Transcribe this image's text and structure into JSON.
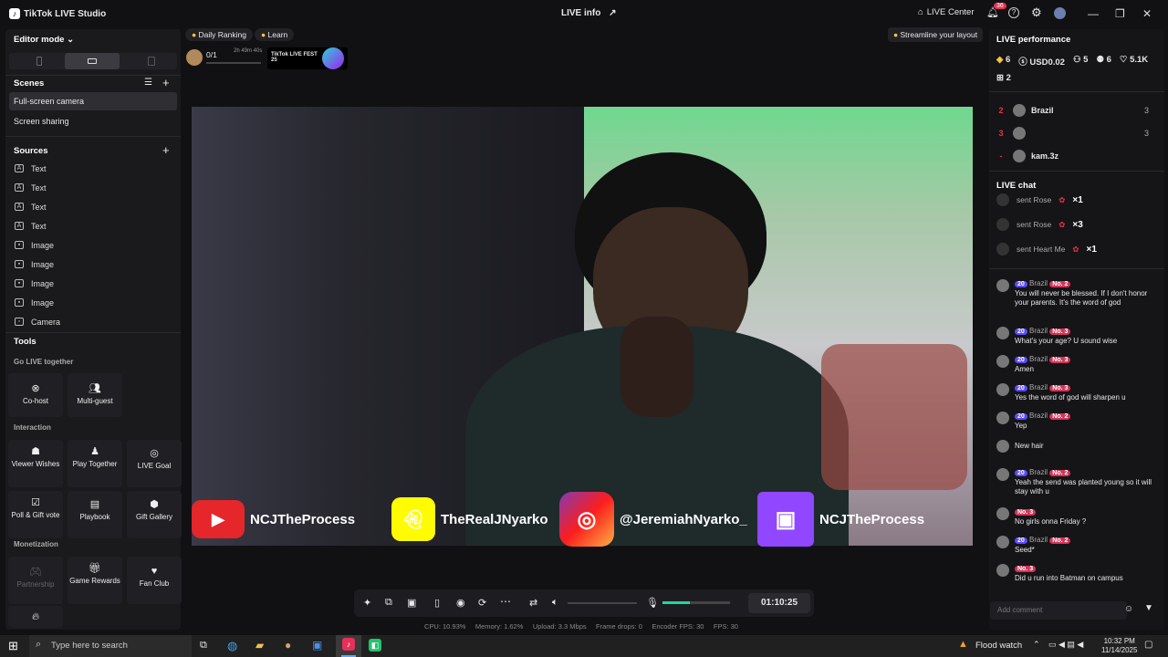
{
  "titlebar": {
    "app_title": "TikTok LIVE Studio",
    "center_title": "LIVE info",
    "live_center": "LIVE Center",
    "notif_count": "36"
  },
  "left": {
    "editor_mode": "Editor mode",
    "scenes_title": "Scenes",
    "scenes": [
      "Full-screen camera",
      "Screen sharing"
    ],
    "sources_title": "Sources",
    "sources": [
      {
        "label": "Text",
        "icon": "text-icon"
      },
      {
        "label": "Text",
        "icon": "text-icon"
      },
      {
        "label": "Text",
        "icon": "text-icon"
      },
      {
        "label": "Text",
        "icon": "text-icon"
      },
      {
        "label": "Image",
        "icon": "image-icon"
      },
      {
        "label": "Image",
        "icon": "image-icon"
      },
      {
        "label": "Image",
        "icon": "image-icon"
      },
      {
        "label": "Image",
        "icon": "image-icon"
      },
      {
        "label": "Camera",
        "icon": "camera-icon"
      }
    ],
    "tools_title": "Tools",
    "go_live_together": "Go LIVE together",
    "cohost": "Co-host",
    "multiguest": "Multi-guest",
    "interaction": "Interaction",
    "viewer_wishes": "Viewer Wishes",
    "play_together": "Play Together",
    "live_goal": "LIVE Goal",
    "poll_gift": "Poll & Gift vote",
    "playbook": "Playbook",
    "gift_gallery": "Gift Gallery",
    "monetization": "Monetization",
    "partnership": "Partnership",
    "game_rewards": "Game Rewards",
    "fan_club": "Fan Club"
  },
  "top": {
    "daily_ranking": "Daily Ranking",
    "learn": "Learn",
    "ranking_value": "0/1",
    "ranking_time": "2h 49m 40s",
    "fest_label": "TikTok LIVE FEST 25",
    "streamline": "Streamline your layout"
  },
  "stage": {
    "social": [
      {
        "handle": "NCJTheProcess",
        "icon": "youtube-icon"
      },
      {
        "handle": "TheRealJNyarko",
        "icon": "snapchat-icon"
      },
      {
        "handle": "@JeremiahNyarko_",
        "icon": "instagram-icon"
      },
      {
        "handle": "NCJTheProcess",
        "icon": "twitch-icon"
      }
    ]
  },
  "controls": {
    "timer": "01:10:25",
    "volume_level": 0.4
  },
  "status": {
    "cpu": "CPU: 10.93%",
    "memory": "Memory: 1.62%",
    "upload": "Upload: 3.3 Mbps",
    "frame_drops": "Frame drops: 0",
    "encoder_fps": "Encoder FPS: 30",
    "fps": "FPS: 30"
  },
  "right": {
    "perf_title": "LIVE performance",
    "stats": [
      "6",
      "USD0.02",
      "5",
      "6",
      "5.1K"
    ],
    "gifts": "2",
    "leaderboard": [
      {
        "rank": "2",
        "name": "Brazil",
        "score": "3"
      },
      {
        "rank": "3",
        "name": "",
        "score": "3"
      },
      {
        "rank": "-",
        "name": "kam.3z",
        "score": ""
      }
    ],
    "chat_title": "LIVE chat",
    "gift_events": [
      {
        "text": "sent Rose",
        "count": "×1"
      },
      {
        "text": "sent Rose",
        "count": "×3"
      },
      {
        "text": "sent Heart Me",
        "count": "×1"
      }
    ],
    "messages": [
      {
        "lvl": "20",
        "user": "Brazil",
        "rank": "No. 2",
        "text": "You will never be blessed. If I don't honor your parents. It's the word of god"
      },
      {
        "lvl": "20",
        "user": "Brazil",
        "rank": "No. 3",
        "text": "What's your age? U sound wise"
      },
      {
        "lvl": "20",
        "user": "Brazil",
        "rank": "No. 3",
        "text": "Amen"
      },
      {
        "lvl": "20",
        "user": "Brazil",
        "rank": "No. 3",
        "text": "Yes the word of god will sharpen u"
      },
      {
        "lvl": "20",
        "user": "Brazil",
        "rank": "No. 2",
        "text": "Yep"
      },
      {
        "lvl": "",
        "user": "",
        "rank": "",
        "text": "New hair"
      },
      {
        "lvl": "20",
        "user": "Brazil",
        "rank": "No. 2",
        "text": "Yeah the send was planted young so it will stay with u"
      },
      {
        "lvl": "",
        "user": "",
        "rank": "No. 3",
        "text": "No girls onna Friday ?"
      },
      {
        "lvl": "20",
        "user": "Brazil",
        "rank": "No. 2",
        "text": "Seed*"
      },
      {
        "lvl": "",
        "user": "",
        "rank": "No. 3",
        "text": "Did u run into Batman on campus"
      }
    ],
    "comment_placeholder": "Add comment"
  },
  "taskbar": {
    "search_placeholder": "Type here to search",
    "weather": "Flood watch",
    "time": "10:32 PM",
    "date": "11/14/2025"
  }
}
